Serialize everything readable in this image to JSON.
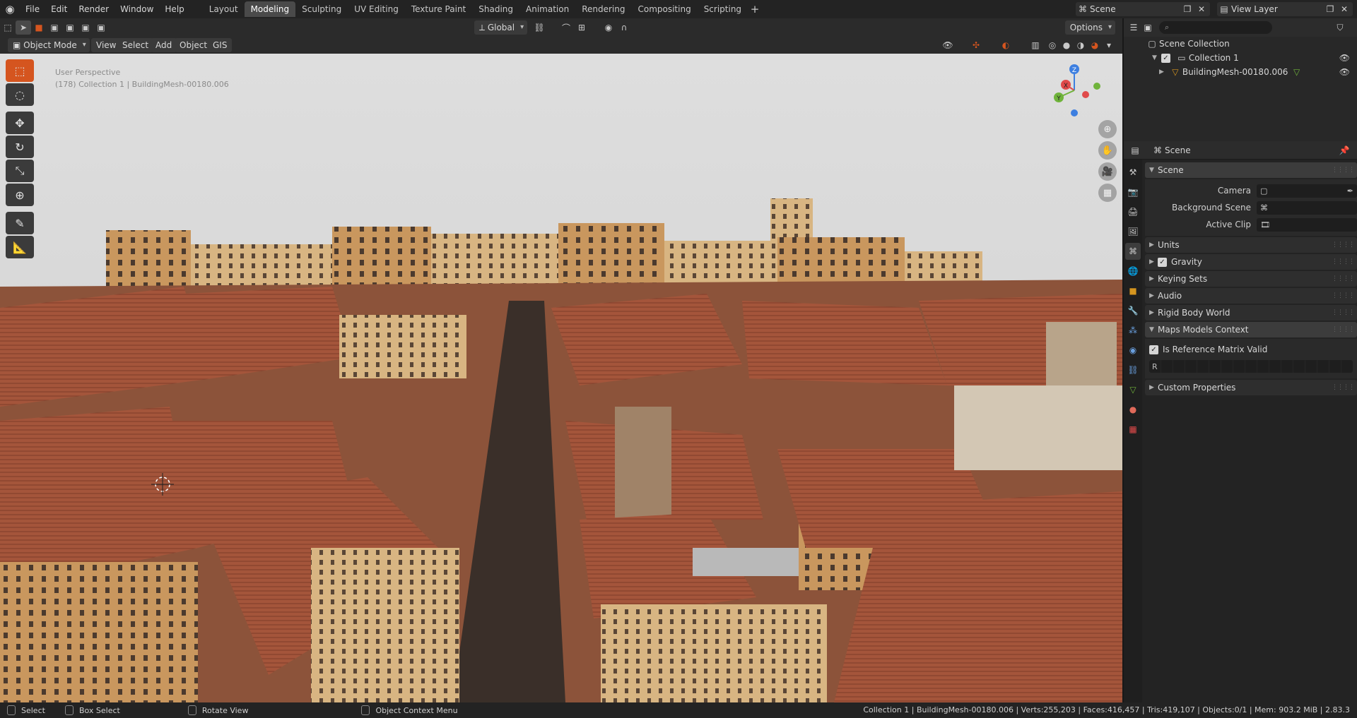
{
  "topbar": {
    "menus": [
      "File",
      "Edit",
      "Render",
      "Window",
      "Help"
    ],
    "workspaces": [
      "Layout",
      "Modeling",
      "Sculpting",
      "UV Editing",
      "Texture Paint",
      "Shading",
      "Animation",
      "Rendering",
      "Compositing",
      "Scripting"
    ],
    "active_workspace": "Modeling",
    "scene_name": "Scene",
    "view_layer": "View Layer"
  },
  "viewport": {
    "mode": "Object Mode",
    "menus": [
      "View",
      "Select",
      "Add",
      "Object",
      "GIS"
    ],
    "transform_orientation": "Global",
    "options_label": "Options",
    "overlay_title": "User Perspective",
    "overlay_subtitle": "(178) Collection 1 | BuildingMesh-00180.006",
    "gizmo_axes": [
      "Z",
      "X",
      "Y"
    ]
  },
  "outliner": {
    "search_placeholder": "",
    "root": "Scene Collection",
    "collection": "Collection 1",
    "object": "BuildingMesh-00180.006"
  },
  "properties": {
    "context": "Scene",
    "panels": {
      "scene": "Scene",
      "camera_label": "Camera",
      "background_label": "Background Scene",
      "clip_label": "Active Clip",
      "units": "Units",
      "gravity": "Gravity",
      "keying_sets": "Keying Sets",
      "audio": "Audio",
      "rigid_body_world": "Rigid Body World",
      "maps_models_context": "Maps Models Context",
      "ref_matrix": "Is Reference Matrix Valid",
      "r_label": "R",
      "custom_properties": "Custom Properties"
    }
  },
  "statusbar": {
    "select": "Select",
    "box_select": "Box Select",
    "rotate_view": "Rotate View",
    "context_menu": "Object Context Menu",
    "stats": "Collection 1 | BuildingMesh-00180.006 | Verts:255,203 | Faces:416,457 | Tris:419,107 | Objects:0/1 | Mem: 903.2 MiB | 2.83.3"
  },
  "colors": {
    "accent": "#d5551f",
    "axis_x": "#e04a4a",
    "axis_y": "#6fb33b",
    "axis_z": "#3d7fe0"
  }
}
